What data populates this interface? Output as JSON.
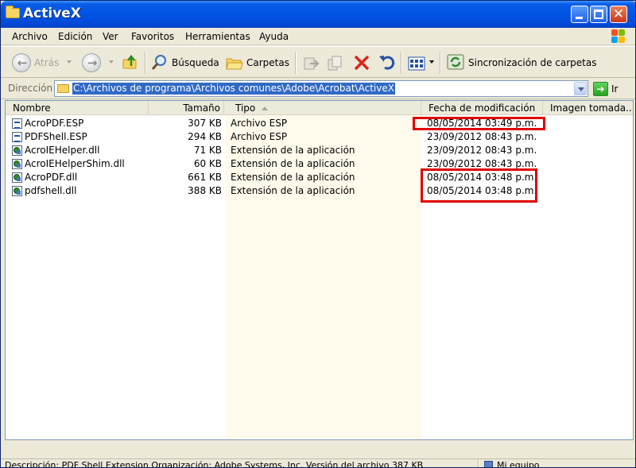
{
  "window": {
    "title": "ActiveX"
  },
  "menu": {
    "items": [
      "Archivo",
      "Edición",
      "Ver",
      "Favoritos",
      "Herramientas",
      "Ayuda"
    ]
  },
  "toolbar": {
    "back_label": "Atrás",
    "search_label": "Búsqueda",
    "folders_label": "Carpetas",
    "sync_label": "Sincronización de carpetas"
  },
  "address": {
    "label": "Dirección",
    "path": "C:\\Archivos de programa\\Archivos comunes\\Adobe\\Acrobat\\ActiveX",
    "go_label": "Ir"
  },
  "columns": [
    "Nombre",
    "Tamaño",
    "Tipo",
    "Fecha de modificación",
    "Imagen tomada..."
  ],
  "files": [
    {
      "name": "AcroPDF.ESP",
      "size": "307 KB",
      "type": "Archivo ESP",
      "date": "08/05/2014 03:49 p.m.",
      "kind": "esp"
    },
    {
      "name": "PDFShell.ESP",
      "size": "294 KB",
      "type": "Archivo ESP",
      "date": "23/09/2012 08:43 p.m.",
      "kind": "esp"
    },
    {
      "name": "AcroIEHelper.dll",
      "size": "71 KB",
      "type": "Extensión de la aplicación",
      "date": "23/09/2012 08:43 p.m.",
      "kind": "dll"
    },
    {
      "name": "AcroIEHelperShim.dll",
      "size": "60 KB",
      "type": "Extensión de la aplicación",
      "date": "23/09/2012 08:43 p.m.",
      "kind": "dll"
    },
    {
      "name": "AcroPDF.dll",
      "size": "661 KB",
      "type": "Extensión de la aplicación",
      "date": "08/05/2014 03:48 p.m.",
      "kind": "dll"
    },
    {
      "name": "pdfshell.dll",
      "size": "388 KB",
      "type": "Extensión de la aplicación",
      "date": "08/05/2014 03:48 p.m.",
      "kind": "dll"
    }
  ],
  "status": {
    "description": "Descripción: PDF Shell Extension Organización: Adobe Systems, Inc. Versión del archivo 387 KB",
    "computer": "Mi equipo"
  },
  "colors": {
    "titlebar": "#0054e3",
    "highlight_box": "#e00000",
    "selection": "#316ac5",
    "sorted_column": "#fffbec"
  },
  "icons": [
    "folder-icon",
    "back-icon",
    "forward-icon",
    "up-folder-icon",
    "search-icon",
    "folders-icon",
    "move-to-icon",
    "copy-to-icon",
    "delete-icon",
    "undo-icon",
    "views-icon",
    "sync-icon",
    "go-icon",
    "windows-logo-icon",
    "computer-icon"
  ]
}
